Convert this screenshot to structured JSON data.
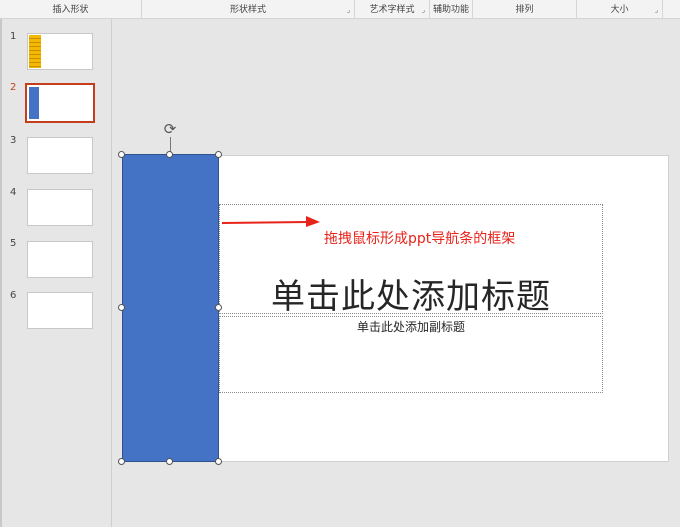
{
  "ribbon": {
    "groups": [
      {
        "label": "插入形状",
        "launcher": false
      },
      {
        "label": "形状样式",
        "launcher": true
      },
      {
        "label": "艺术字样式",
        "launcher": true
      },
      {
        "label": "辅助功能",
        "launcher": false
      },
      {
        "label": "排列",
        "launcher": false
      },
      {
        "label": "大小",
        "launcher": true
      }
    ],
    "launcher_glyph": "⌟"
  },
  "thumbnails": [
    {
      "number": "1",
      "active": false,
      "content": "ruler-graphic"
    },
    {
      "number": "2",
      "active": true,
      "content": "blue-bar"
    },
    {
      "number": "3",
      "active": false,
      "content": "blank"
    },
    {
      "number": "4",
      "active": false,
      "content": "blank"
    },
    {
      "number": "5",
      "active": false,
      "content": "blank"
    },
    {
      "number": "6",
      "active": false,
      "content": "blank"
    }
  ],
  "slide": {
    "title_placeholder": "单击此处添加标题",
    "subtitle_placeholder": "单击此处添加副标题",
    "annotation": "拖拽鼠标形成ppt导航条的框架"
  },
  "shape": {
    "fill": "#4472c4",
    "rotate_glyph": "⟳"
  },
  "colors": {
    "accent": "#c43e1c",
    "annotation": "#e8231a"
  }
}
